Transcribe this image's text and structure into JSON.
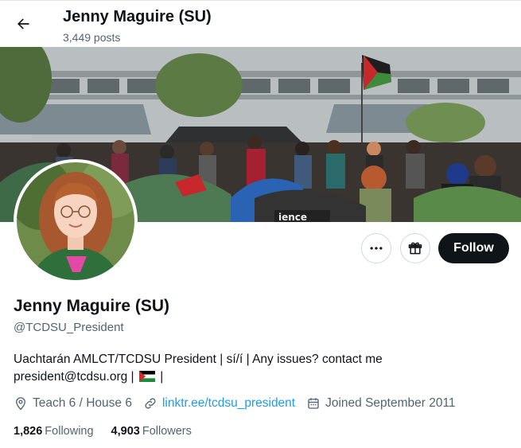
{
  "header": {
    "title": "Jenny Maguire (SU)",
    "posts": "3,449 posts",
    "back_icon": "back-arrow-icon"
  },
  "profile": {
    "name": "Jenny Maguire (SU)",
    "handle": "@TCDSU_President",
    "bio_line1": "Uachtarán AMLCT/TCDSU President | sí/í | Any issues? contact me",
    "bio_line2_text": "president@tcdsu.org |",
    "bio_line2_end": "|",
    "location": "Teach 6 / House 6",
    "link": "linktr.ee/tcdsu_president",
    "joined": "Joined September 2011"
  },
  "actions": {
    "more_icon": "more-options-icon",
    "gift_icon": "gift-icon",
    "follow_label": "Follow"
  },
  "stats": {
    "following_count": "1,826",
    "following_label": "Following",
    "followers_count": "4,903",
    "followers_label": "Followers"
  },
  "colors": {
    "text_primary": "#0f1419",
    "text_secondary": "#536471",
    "link": "#1d9bf0",
    "follow_bg": "#0f1419"
  }
}
